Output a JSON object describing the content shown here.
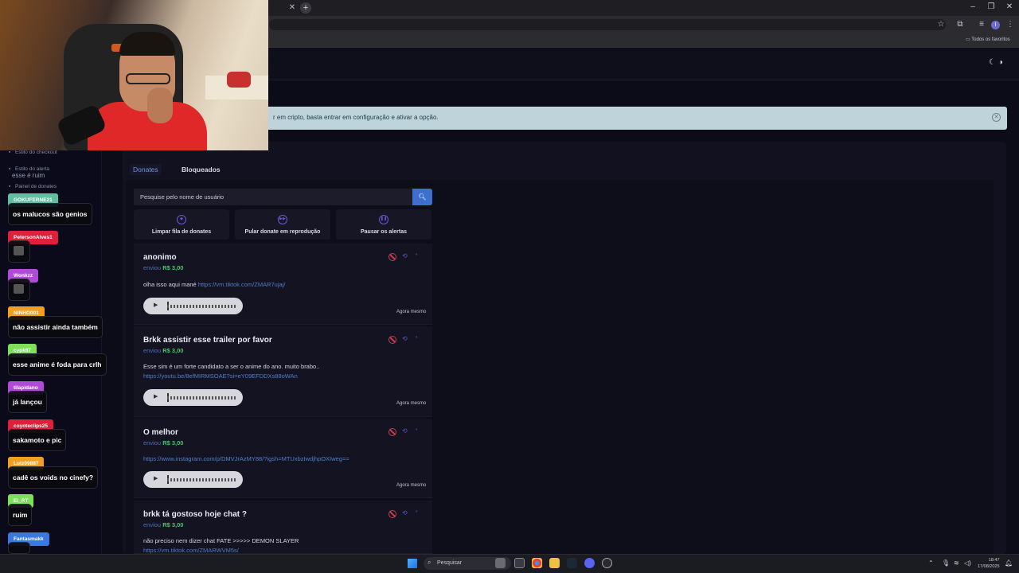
{
  "browser": {
    "bookmarks_label": "Todos os favoritos",
    "profile_initial": "I"
  },
  "alert": {
    "text": "r em cripto, basta entrar em configuração e ativar a opção."
  },
  "sidebar": {
    "items": [
      {
        "label": "Estilo do checkout"
      },
      {
        "label": "Estilo do alerta"
      },
      {
        "label": "Painel de donates"
      }
    ]
  },
  "tabs": [
    {
      "label": "Donates",
      "active": true
    },
    {
      "label": "Bloqueados",
      "active": false
    }
  ],
  "search": {
    "placeholder": "Pesquise pelo nome de usuário"
  },
  "actions": [
    {
      "label": "Limpar fila de donates",
      "icon": "eraser-icon"
    },
    {
      "label": "Pular donate em reprodução",
      "icon": "skip-icon"
    },
    {
      "label": "Pausar os alertas",
      "icon": "pause-icon"
    }
  ],
  "donations": [
    {
      "name": "anonimo",
      "sent_prefix": "enviou",
      "amount": "R$ 3,00",
      "message": "olha isso aqui mané",
      "link": "https://vm.tiktok.com/ZMAR7ujaj/",
      "time": "Agora mesmo"
    },
    {
      "name": "Brkk assistir esse trailer por favor",
      "sent_prefix": "enviou",
      "amount": "R$ 3,00",
      "message": "Esse sim é um forte candidato a ser o anime do ano. muito brabo..",
      "link": "https://youtu.be/8efMIRMSOAE?si=eY09EFDDXs88oWAn",
      "time": "Agora mesmo"
    },
    {
      "name": "O melhor",
      "sent_prefix": "enviou",
      "amount": "R$ 3,00",
      "message": "",
      "link": "https://www.instagram.com/p/DMVJrAzMY88/?igsh=MTUxbzIwdjhpOXIweg==",
      "time": "Agora mesmo"
    },
    {
      "name": "brkk tá gostoso hoje chat ?",
      "sent_prefix": "enviou",
      "amount": "R$ 3,00",
      "message": "não preciso nem dizer chat FATE >>>>> DEMON SLAYER",
      "link": "https://vm.tiktok.com/ZMARWVM5s/",
      "time": ""
    }
  ],
  "chat": {
    "ghost_text": "esse é ruim",
    "entries": [
      {
        "user": "GOKUFERNE21",
        "color": "#5fbf9f",
        "message": "os malucos são genios"
      },
      {
        "user": "PetersonAlves1",
        "color": "#e0203a",
        "message": ""
      },
      {
        "user": "Wonkzz",
        "color": "#b04ad8",
        "message": ""
      },
      {
        "user": "NINHO001",
        "color": "#f0a020",
        "message": "não assistir ainda também"
      },
      {
        "user": "cypk67",
        "color": "#7ee05a",
        "message": "esse anime é foda para crlh"
      },
      {
        "user": "tilapidano",
        "color": "#b04ad8",
        "message": "já lançou"
      },
      {
        "user": "coyoteclips25",
        "color": "#e0203a",
        "message": "sakamoto e pic"
      },
      {
        "user": "Lutz09887",
        "color": "#f0a020",
        "message": "cadê os voids no cinefy?"
      },
      {
        "user": "El_RT",
        "color": "#7ee05a",
        "message": "ruim"
      },
      {
        "user": "Fantasmakk",
        "color": "#3a78e0",
        "message": ""
      }
    ]
  },
  "taskbar": {
    "search_placeholder": "Pesquisar",
    "time": "18:47",
    "date": "17/08/2025"
  }
}
